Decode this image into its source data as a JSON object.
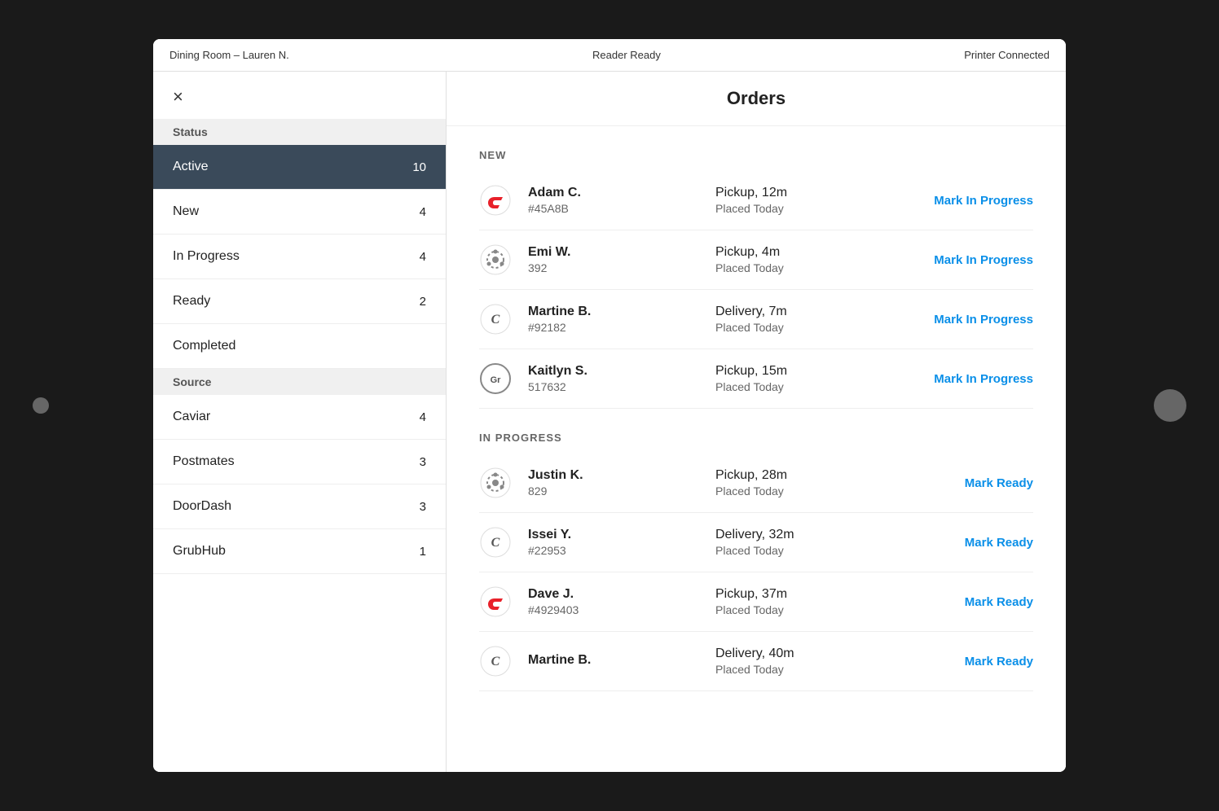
{
  "topBar": {
    "left": "Dining Room – Lauren N.",
    "center": "Reader Ready",
    "right": "Printer Connected"
  },
  "header": {
    "title": "Orders",
    "close_label": "×"
  },
  "sidebar": {
    "sections": [
      {
        "label": "Status",
        "items": [
          {
            "id": "active",
            "label": "Active",
            "count": "10",
            "active": true
          },
          {
            "id": "new",
            "label": "New",
            "count": "4",
            "active": false
          },
          {
            "id": "in-progress",
            "label": "In Progress",
            "count": "4",
            "active": false
          },
          {
            "id": "ready",
            "label": "Ready",
            "count": "2",
            "active": false
          },
          {
            "id": "completed",
            "label": "Completed",
            "count": "",
            "active": false
          }
        ]
      },
      {
        "label": "Source",
        "items": [
          {
            "id": "caviar",
            "label": "Caviar",
            "count": "4",
            "active": false
          },
          {
            "id": "postmates",
            "label": "Postmates",
            "count": "3",
            "active": false
          },
          {
            "id": "doordash",
            "label": "DoorDash",
            "count": "3",
            "active": false
          },
          {
            "id": "grubhub",
            "label": "GrubHub",
            "count": "1",
            "active": false
          }
        ]
      }
    ]
  },
  "orders": {
    "sections": [
      {
        "title": "NEW",
        "items": [
          {
            "name": "Adam C.",
            "id": "#45A8B",
            "type": "Pickup, 12m",
            "placed": "Placed Today",
            "icon": "doordash",
            "action": "Mark In Progress"
          },
          {
            "name": "Emi W.",
            "id": "392",
            "type": "Pickup, 4m",
            "placed": "Placed Today",
            "icon": "postmates",
            "action": "Mark In Progress"
          },
          {
            "name": "Martine B.",
            "id": "#92182",
            "type": "Delivery, 7m",
            "placed": "Placed Today",
            "icon": "caviar",
            "action": "Mark In Progress"
          },
          {
            "name": "Kaitlyn S.",
            "id": "517632",
            "type": "Pickup, 15m",
            "placed": "Placed Today",
            "icon": "grubhub",
            "action": "Mark In Progress"
          }
        ]
      },
      {
        "title": "IN PROGRESS",
        "items": [
          {
            "name": "Justin K.",
            "id": "829",
            "type": "Pickup, 28m",
            "placed": "Placed Today",
            "icon": "postmates",
            "action": "Mark Ready"
          },
          {
            "name": "Issei Y.",
            "id": "#22953",
            "type": "Delivery, 32m",
            "placed": "Placed Today",
            "icon": "caviar",
            "action": "Mark Ready"
          },
          {
            "name": "Dave J.",
            "id": "#4929403",
            "type": "Pickup, 37m",
            "placed": "Placed Today",
            "icon": "doordash",
            "action": "Mark Ready"
          },
          {
            "name": "Martine B.",
            "id": "",
            "type": "Delivery, 40m",
            "placed": "Placed Today",
            "icon": "caviar",
            "action": "Mark Ready"
          }
        ]
      }
    ]
  },
  "icons": {
    "doordash_symbol": "D",
    "caviar_symbol": "C",
    "grubhub_symbol": "Gr",
    "postmates_symbol": "✳"
  }
}
